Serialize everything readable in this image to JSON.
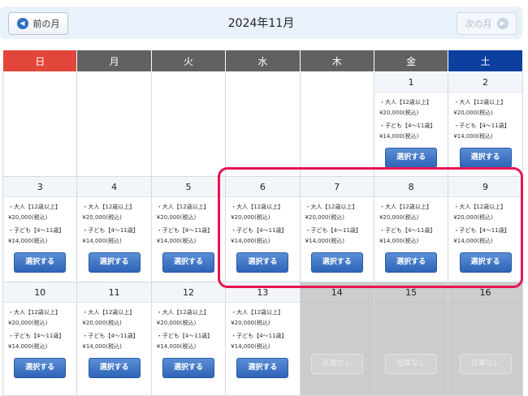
{
  "nav": {
    "prev_label": "前の月",
    "next_label": "次の月",
    "title": "2024年11月",
    "prev_icon": "chevron-left-circle-icon",
    "next_icon": "chevron-right-circle-icon"
  },
  "weekdays": [
    "日",
    "月",
    "火",
    "水",
    "木",
    "金",
    "土"
  ],
  "colors": {
    "sunday_header": "#e2463a",
    "saturday_header": "#0d3f9f",
    "weekday_header": "#616161",
    "select_button": "#2f64b7",
    "highlight_border": "#e8144f",
    "unavailable_cell": "#cccccc"
  },
  "price": {
    "adult_label": "・大人【12歳以上】",
    "adult_price": "¥20,000(税込)",
    "child_label": "・子ども【4～11歳】",
    "child_price": "¥14,000(税込)"
  },
  "select_label": "選択する",
  "soldout_label": "在庫なし",
  "weeks": [
    [
      {
        "date": ""
      },
      {
        "date": ""
      },
      {
        "date": ""
      },
      {
        "date": ""
      },
      {
        "date": ""
      },
      {
        "date": "1",
        "status": "available"
      },
      {
        "date": "2",
        "status": "available"
      }
    ],
    [
      {
        "date": "3",
        "status": "available"
      },
      {
        "date": "4",
        "status": "available"
      },
      {
        "date": "5",
        "status": "available"
      },
      {
        "date": "6",
        "status": "available"
      },
      {
        "date": "7",
        "status": "available"
      },
      {
        "date": "8",
        "status": "available"
      },
      {
        "date": "9",
        "status": "available"
      }
    ],
    [
      {
        "date": "10",
        "status": "available"
      },
      {
        "date": "11",
        "status": "available"
      },
      {
        "date": "12",
        "status": "available"
      },
      {
        "date": "13",
        "status": "available"
      },
      {
        "date": "14",
        "status": "soldout"
      },
      {
        "date": "15",
        "status": "soldout"
      },
      {
        "date": "16",
        "status": "soldout"
      }
    ]
  ]
}
